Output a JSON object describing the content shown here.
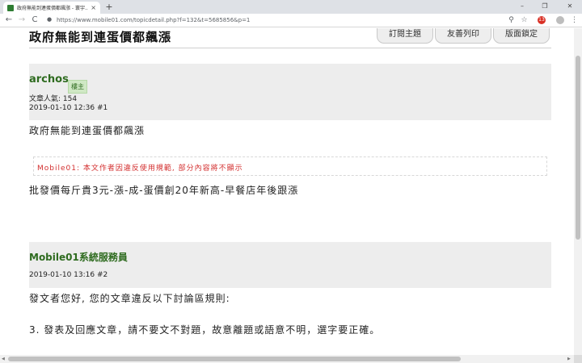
{
  "browser": {
    "tab_title": "政府無能到連蛋價都飆漲 - 寰宇...",
    "tab_close": "×",
    "new_tab": "+",
    "window_controls": [
      "–",
      "❐",
      "✕"
    ],
    "url": "https://www.mobile01.com/topicdetail.php?f=132&t=5685856&p=1",
    "ext_badge": "13",
    "nav": {
      "back": "←",
      "forward": "→",
      "reload": "C"
    }
  },
  "page": {
    "title": "政府無能到連蛋價都飆漲",
    "actions": [
      "訂閱主題",
      "友善列印",
      "版面鎖定"
    ]
  },
  "posts": [
    {
      "author": "archos",
      "role": "樓主",
      "popularity": "文章人氣: 154",
      "datetime": "2019-01-10 12:36 #1",
      "lines": [
        "政府無能到連蛋價都飆漲",
        "Mobile01: 本文作者因違反使用規範, 部分內容將不顯示",
        "批發價每斤貴3元-漲-成-蛋價創20年新高-早餐店年後跟漲"
      ]
    },
    {
      "author": "Mobile01系統服務員",
      "datetime": "2019-01-10 13:16 #2",
      "lines": [
        "發文者您好, 您的文章違反以下討論區規則:",
        "3. 發表及回應文章，請不要文不對題，故意離題或語意不明，選字要正確。"
      ]
    }
  ],
  "colors": {
    "author_green": "#2e6b1f",
    "notice_red": "#d32f2f",
    "header_gray": "#ededed"
  }
}
